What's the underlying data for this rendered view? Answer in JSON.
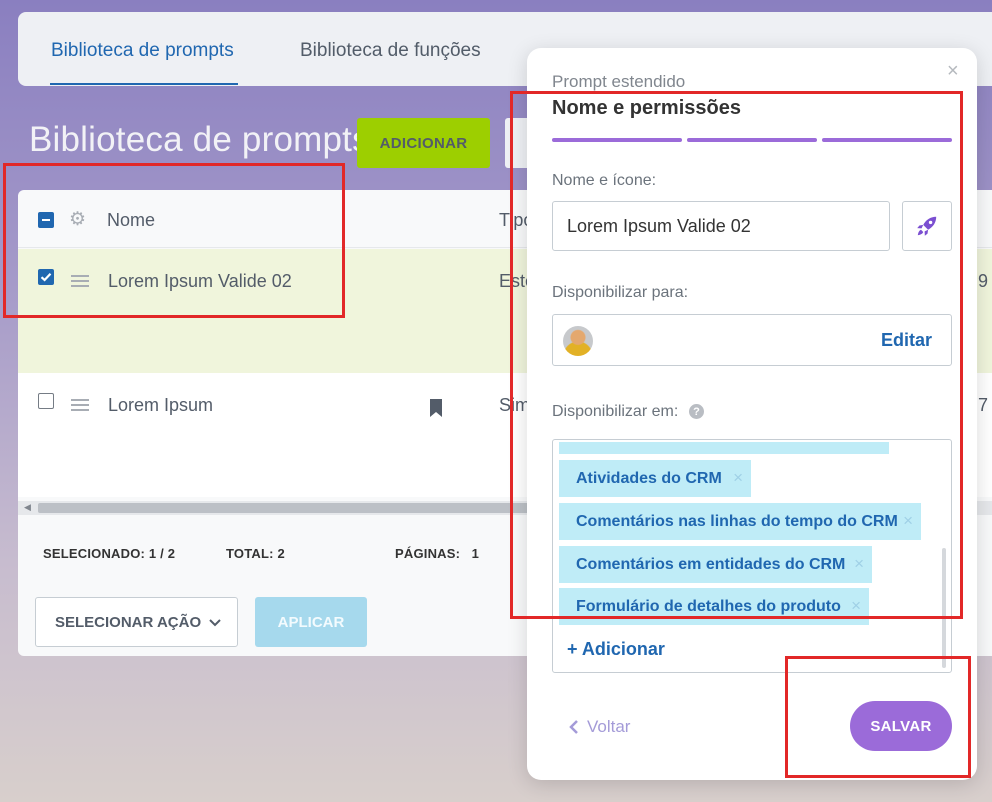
{
  "tabs": [
    {
      "label": "Biblioteca de prompts",
      "active": true
    },
    {
      "label": "Biblioteca de funções",
      "active": false
    }
  ],
  "page": {
    "title": "Biblioteca de prompts",
    "add_label": "ADICIONAR"
  },
  "table": {
    "columns": [
      "Nome",
      "Tipo"
    ],
    "rows": [
      {
        "name": "Lorem Ipsum Valide 02",
        "type": "Este",
        "trailing": "9",
        "selected": true
      },
      {
        "name": "Lorem Ipsum",
        "type": "Sim",
        "trailing": "7",
        "selected": false
      }
    ]
  },
  "footer": {
    "selected_label": "SELECIONADO:",
    "selected_value": "1 / 2",
    "total_label": "TOTAL:",
    "total_value": "2",
    "pages_label": "PÁGINAS:",
    "pages_value": "1",
    "select_action": "SELECIONAR AÇÃO",
    "apply": "APLICAR"
  },
  "modal": {
    "subtitle": "Prompt estendido",
    "title": "Nome e permissões",
    "close": "×",
    "name_label": "Nome e ícone:",
    "name_value": "Lorem Ipsum Valide 02",
    "icon": "rocket-icon",
    "share_label": "Disponibilizar para:",
    "edit_label": "Editar",
    "available_in_label": "Disponibilizar em:",
    "help": "?",
    "tags": [
      "Atividades do CRM",
      "Comentários nas linhas do tempo do CRM",
      "Comentários em entidades do CRM",
      "Formulário de detalhes do produto"
    ],
    "add_tag": "+ Adicionar",
    "back_label": "Voltar",
    "save_label": "SALVAR"
  },
  "colors": {
    "accent_blue": "#2067b0",
    "accent_purple": "#9b6bd9",
    "add_green": "#9dcf00",
    "tag_bg": "#bfecf7",
    "annotation_red": "#e22828"
  }
}
